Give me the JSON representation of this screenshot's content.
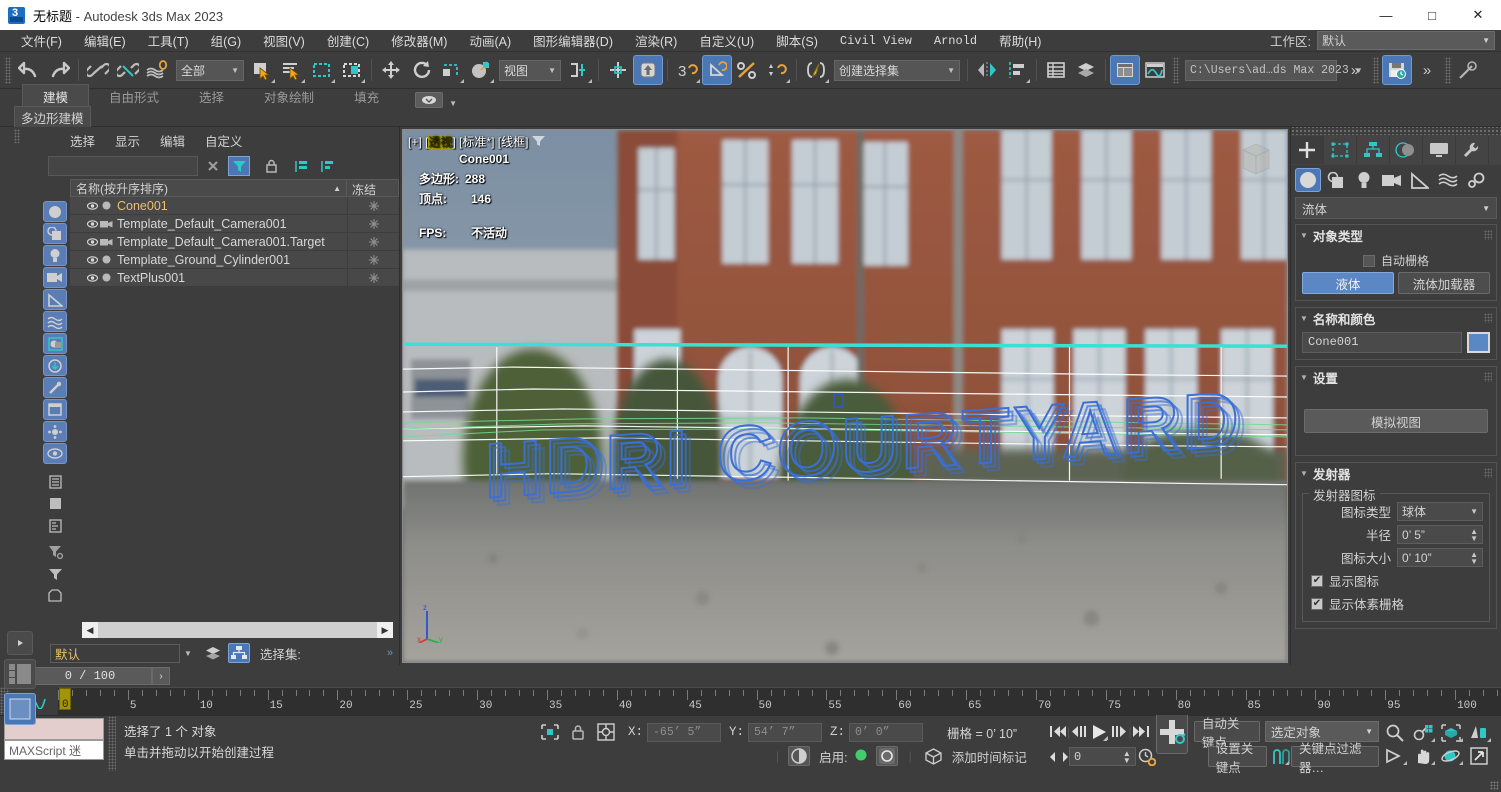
{
  "titlebar": {
    "doc": "无标题",
    "app": " - Autodesk 3ds Max 2023",
    "minimize": "—",
    "maximize": "□",
    "close": "✕"
  },
  "menubar": {
    "items": [
      {
        "label": "文件(F)"
      },
      {
        "label": "编辑(E)"
      },
      {
        "label": "工具(T)"
      },
      {
        "label": "组(G)"
      },
      {
        "label": "视图(V)"
      },
      {
        "label": "创建(C)"
      },
      {
        "label": "修改器(M)"
      },
      {
        "label": "动画(A)"
      },
      {
        "label": "图形编辑器(D)"
      },
      {
        "label": "渲染(R)"
      },
      {
        "label": "自定义(U)"
      },
      {
        "label": "脚本(S)"
      },
      {
        "label": "Civil View"
      },
      {
        "label": "Arnold"
      },
      {
        "label": "帮助(H)"
      }
    ],
    "workspace_label": "工作区:",
    "workspace_value": "默认"
  },
  "toolbar": {
    "selection_filter": "全部",
    "reference_coord": "视图",
    "named_selection_set": "创建选择集",
    "project_path": "C:\\Users\\ad…ds Max 2023",
    "overflow": "»",
    "overflow2": "»"
  },
  "ribbon": {
    "tabs": [
      {
        "label": "建模",
        "active": true
      },
      {
        "label": "自由形式",
        "active": false
      },
      {
        "label": "选择",
        "active": false
      },
      {
        "label": "对象绘制",
        "active": false
      },
      {
        "label": "填充",
        "active": false
      }
    ],
    "subtab": "多边形建模"
  },
  "explorer": {
    "menu": [
      "选择",
      "显示",
      "编辑",
      "自定义"
    ],
    "search_value": "",
    "columns": {
      "name": "名称(按升序排序)",
      "frozen": "冻结"
    },
    "rows": [
      {
        "name": "Cone001",
        "type": "geometry",
        "selected": true
      },
      {
        "name": "Template_Default_Camera001",
        "type": "camera",
        "selected": false
      },
      {
        "name": "Template_Default_Camera001.Target",
        "type": "camera",
        "selected": false
      },
      {
        "name": "Template_Ground_Cylinder001",
        "type": "geometry",
        "selected": false
      },
      {
        "name": "TextPlus001",
        "type": "geometry",
        "selected": false
      }
    ],
    "layer_value": "默认",
    "selection_set_label": "选择集:"
  },
  "viewport": {
    "label_plus": "[+]",
    "label_view": "透视",
    "label_shading": "标准*",
    "label_style": "线框",
    "object_name": "Cone001",
    "poly_label": "多边形:",
    "poly_value": "288",
    "vert_label": "顶点:",
    "vert_value": "146",
    "fps_label": "FPS:",
    "fps_value": "不活动",
    "scene_text": "HDRI COURTYARD",
    "axis_x": "x",
    "axis_y": "y",
    "axis_z": "z"
  },
  "command_panel": {
    "dropdown": "流体",
    "object_type": {
      "title": "对象类型",
      "autogrid": "自动栅格",
      "buttons": [
        {
          "label": "液体",
          "active": true
        },
        {
          "label": "流体加载器",
          "active": false
        }
      ]
    },
    "name_color": {
      "title": "名称和颜色",
      "name": "Cone001",
      "color": "#5b87c4"
    },
    "settings": {
      "title": "设置",
      "sim_view_button": "模拟视图"
    },
    "emitter": {
      "title": "发射器",
      "group_title": "发射器图标",
      "icon_type_label": "图标类型",
      "icon_type_value": "球体",
      "radius_label": "半径",
      "radius_value": "0’ 5”",
      "icon_size_label": "图标大小",
      "icon_size_value": "0’ 10”",
      "show_icon": "显示图标",
      "show_voxel_grid": "显示体素栅格"
    }
  },
  "timeline": {
    "frame_field": "0 / 100",
    "prev": "‹",
    "next": "›",
    "playhead_label": "0",
    "range_start": 0,
    "range_end": 100,
    "visible_end": 103,
    "tick_labels": [
      5,
      10,
      15,
      20,
      25,
      30,
      35,
      40,
      45,
      50,
      55,
      60,
      65,
      70,
      75,
      80,
      85,
      90,
      95,
      100
    ]
  },
  "statusbar": {
    "maxscript_prompt": "MAXScript 迷",
    "message1": "选择了 1 个 对象",
    "message2": "单击并拖动以开始创建过程",
    "x_label": "X:",
    "x_value": "-65’ 5”",
    "y_label": "Y:",
    "y_value": "54’ 7”",
    "z_label": "Z:",
    "z_value": "0’ 0”",
    "grid_text": "栅格 = 0’ 10”",
    "enable_label": "启用:",
    "key_counter": "0",
    "add_time_tag": "添加时间标记"
  },
  "animation": {
    "auto_key": "自动关键点",
    "set_key": "设置关键点",
    "key_filters": "关键点过滤器…",
    "selection_mode": "选定对象",
    "current_frame": "0"
  }
}
